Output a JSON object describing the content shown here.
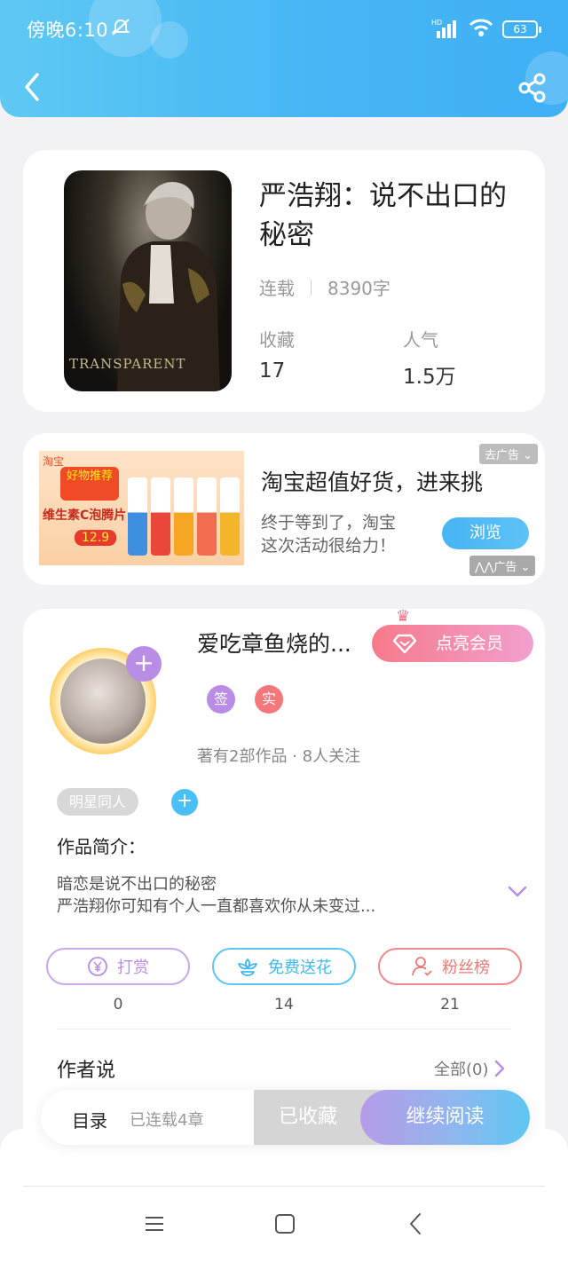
{
  "status_bar": {
    "time": "傍晚6:10",
    "network": "HD",
    "battery": "63"
  },
  "header": {
    "back_icon": "chevron-left-icon",
    "share_icon": "share-icon"
  },
  "book": {
    "cover_text": "TRANSPARENT",
    "title": "严浩翔：说不出口的秘密",
    "status": "连载",
    "word_count": "8390字",
    "favorites_label": "收藏",
    "favorites_value": "17",
    "popularity_label": "人气",
    "popularity_value": "1.5万"
  },
  "ad": {
    "image_brand": "淘宝",
    "image_tag": "好物推荐",
    "image_product": "维生素C泡腾片",
    "image_price": "12.9",
    "close_label": "去广告",
    "title": "淘宝超值好货，进来挑",
    "description": "终于等到了，淘宝这次活动很给力！",
    "browse_label": "浏览",
    "ad_label": "广告"
  },
  "author": {
    "name": "爱吃章鱼烧的...",
    "vip_label": "点亮会员",
    "badge_sign": "签",
    "badge_real": "实",
    "stats": "著有2部作品 · 8人关注",
    "genre_tag": "明星同人",
    "intro_label": "作品简介：",
    "intro_line1": "暗恋是说不出口的秘密",
    "intro_line2": "严浩翔你可知有个人一直都喜欢你从未变过..."
  },
  "actions": {
    "tip_label": "打赏",
    "tip_count": "0",
    "flower_label": "免费送花",
    "flower_count": "14",
    "fans_label": "粉丝榜",
    "fans_count": "21"
  },
  "author_says": {
    "label": "作者说",
    "view_all": "全部(0)"
  },
  "bottom_bar": {
    "toc_label": "目录",
    "chapter_count": "已连载4章",
    "collected_label": "已收藏",
    "continue_label": "继续阅读"
  },
  "colors": {
    "header_blue": "#46b6f5",
    "accent_purple": "#b98de6",
    "tip_border": "#c9a8ec",
    "flower_border": "#5ac8ef",
    "fans_border": "#f08a8a",
    "vip_pink": "#f67a8a"
  }
}
